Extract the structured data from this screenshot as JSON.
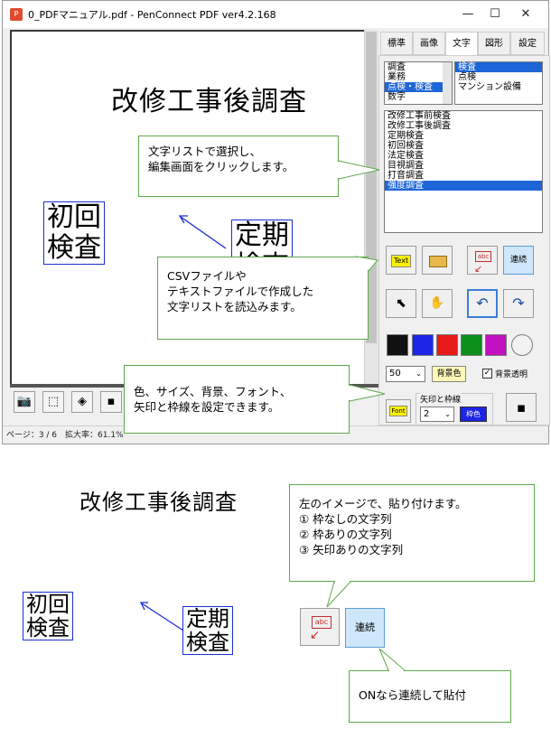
{
  "window": {
    "title": "0_PDFマニュアル.pdf - PenConnect PDF ver4.2.168",
    "minimize": "—",
    "maximize": "☐",
    "close": "✕"
  },
  "canvas": {
    "heading": "改修工事後調査",
    "box1_line1": "初回",
    "box1_line2": "検査",
    "box2_line1": "定期",
    "box2_line2": "検査"
  },
  "status": {
    "text": "ページ：3 / 6　拡大率：61.1%"
  },
  "tabs": [
    "標準",
    "画像",
    "文字",
    "図形",
    "設定"
  ],
  "list_category": [
    "調査",
    "業務",
    "点検・検査",
    "数字"
  ],
  "list_sub": [
    "検査",
    "点検",
    "マンション設備"
  ],
  "list_words": [
    "改修工事前検査",
    "改修工事後調査",
    "定期検査",
    "初回検査",
    "法定検査",
    "目視調査",
    "打音調査",
    "強度調査"
  ],
  "buttons": {
    "text_btn": "Text",
    "continuous": "連続",
    "abc": "abc",
    "font_size": "50",
    "bg_color": "背景色",
    "bg_transparent": "背景透明",
    "font_btn": "Font",
    "arrow_border_label": "矢印と枠線",
    "arrow_size": "2",
    "border_btn": "枠色"
  },
  "callouts": {
    "c1_line1": "文字リストで選択し、",
    "c1_line2": "編集画面をクリックします。",
    "c2_line1": "CSVファイルや",
    "c2_line2": "テキストファイルで作成した",
    "c2_line3": "文字リストを読込みます。",
    "c3_line1": "色、サイズ、背景、フォント、",
    "c3_line2": "矢印と枠線を設定できます。",
    "c4_line1": "左のイメージで、貼り付けます。",
    "c4_line2": "① 枠なしの文字列",
    "c4_line3": "② 枠ありの文字列",
    "c4_line4": "③ 矢印ありの文字列",
    "c5": "ONなら連続して貼付"
  },
  "colors": {
    "accent": "#1e66d8",
    "callout_border": "#5fa84b",
    "box_border": "#1a2fd6"
  }
}
